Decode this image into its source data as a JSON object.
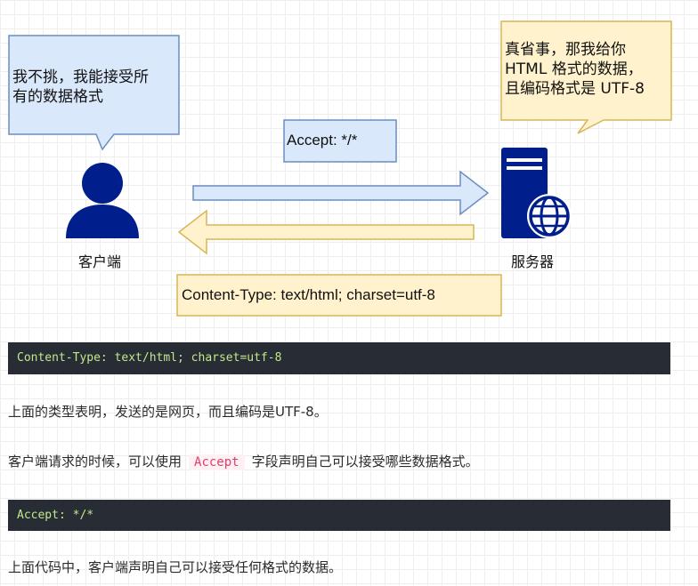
{
  "diagram": {
    "client_bubble": "我不挑，我能接受所\n有的数据格式",
    "server_bubble": "真省事，那我给你\nHTML 格式的数据，\n且编码格式是 UTF-8",
    "request_label": "Accept: */*",
    "response_label": "Content-Type: text/html; charset=utf-8",
    "client_label": "客户端",
    "server_label": "服务器",
    "colors": {
      "blue_fill": "#dae8fc",
      "blue_stroke": "#6c8ebf",
      "yellow_fill": "#fff2cc",
      "yellow_stroke": "#d6b656",
      "icon": "#001f8c"
    },
    "icons": [
      "user-icon",
      "server-globe-icon"
    ]
  },
  "article": {
    "code1": "Content-Type: text/html; charset=utf-8",
    "p1": "上面的类型表明，发送的是网页，而且编码是UTF-8。",
    "p2_before": "客户端请求的时候，可以使用",
    "p2_code": "Accept",
    "p2_after": "字段声明自己可以接受哪些数据格式。",
    "code2": "Accept: */*",
    "p3": "上面代码中，客户端声明自己可以接受任何格式的数据。"
  }
}
